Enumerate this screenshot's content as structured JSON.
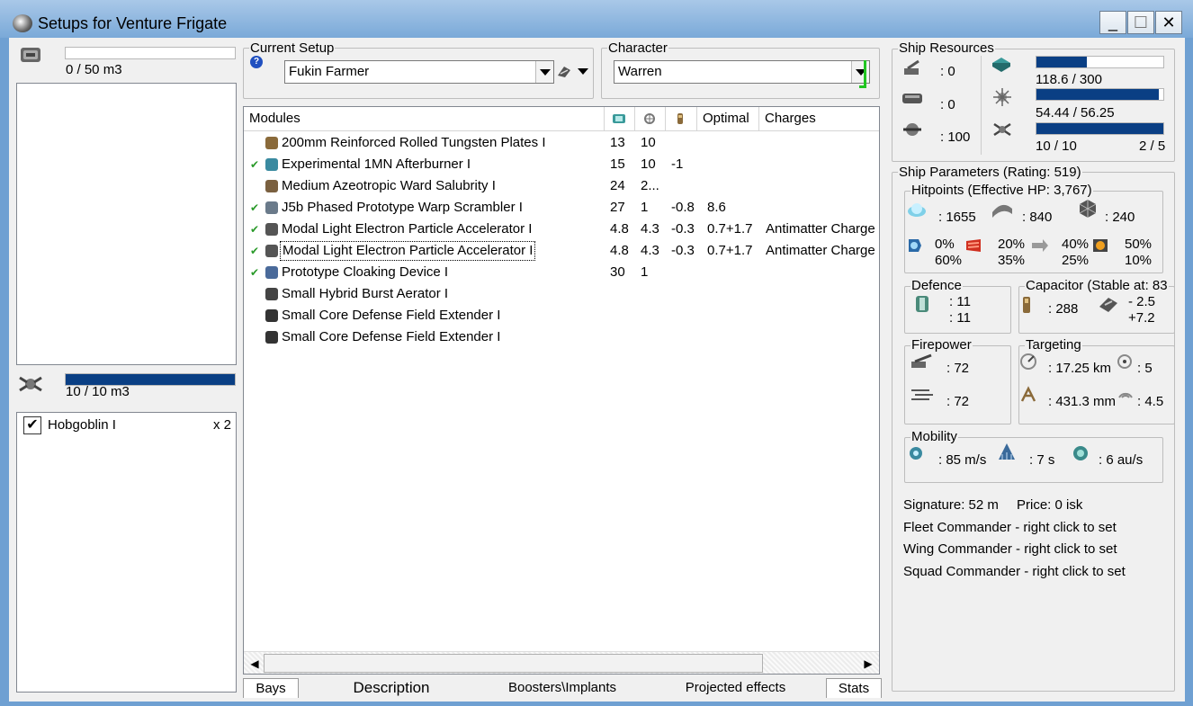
{
  "window": {
    "title": "Setups for Venture Frigate",
    "minimize": "_",
    "maximize": "☐",
    "close": "✕"
  },
  "cargo": {
    "capacity_text": "0 / 50 m3",
    "fill_fraction": 0.0
  },
  "drones": {
    "capacity_text": "10 / 10 m3",
    "fill_fraction": 1.0,
    "items": [
      {
        "name": "Hobgoblin I",
        "count": "x 2",
        "checked": true
      }
    ]
  },
  "current_setup": {
    "label": "Current Setup",
    "value": "Fukin Farmer"
  },
  "character": {
    "label": "Character",
    "value": "Warren"
  },
  "modules_table": {
    "headers": {
      "name": "Modules",
      "optimal": "Optimal",
      "charges": "Charges"
    },
    "rows": [
      {
        "name": "200mm Reinforced Rolled Tungsten Plates I",
        "cpu": "13",
        "pg": "10",
        "cap": "",
        "optimal": "",
        "charges": "",
        "active": false,
        "icon": "armor-plate-icon",
        "color": "#8a6a3a"
      },
      {
        "name": "Experimental 1MN Afterburner I",
        "cpu": "15",
        "pg": "10",
        "cap": "-1",
        "optimal": "",
        "charges": "",
        "active": true,
        "icon": "afterburner-icon",
        "color": "#3a8aa0"
      },
      {
        "name": "Medium Azeotropic Ward Salubrity I",
        "cpu": "24",
        "pg": "2...",
        "cap": "",
        "optimal": "",
        "charges": "",
        "active": false,
        "icon": "rig-icon",
        "color": "#7a6040"
      },
      {
        "name": "J5b Phased Prototype Warp Scrambler I",
        "cpu": "27",
        "pg": "1",
        "cap": "-0.8",
        "optimal": "8.6",
        "charges": "",
        "active": true,
        "icon": "warp-scrambler-icon",
        "color": "#6a7a8a"
      },
      {
        "name": "Modal Light Electron Particle Accelerator I",
        "cpu": "4.8",
        "pg": "4.3",
        "cap": "-0.3",
        "optimal": "0.7+1.7",
        "charges": "Antimatter Charge",
        "active": true,
        "icon": "hybrid-turret-icon",
        "color": "#555"
      },
      {
        "name": "Modal Light Electron Particle Accelerator I",
        "cpu": "4.8",
        "pg": "4.3",
        "cap": "-0.3",
        "optimal": "0.7+1.7",
        "charges": "Antimatter Charge",
        "active": true,
        "icon": "hybrid-turret-icon",
        "color": "#555"
      },
      {
        "name": "Prototype Cloaking Device I",
        "cpu": "30",
        "pg": "1",
        "cap": "",
        "optimal": "",
        "charges": "",
        "active": true,
        "icon": "cloak-icon",
        "color": "#4a6a9a"
      },
      {
        "name": "Small Hybrid Burst Aerator I",
        "cpu": "",
        "pg": "",
        "cap": "",
        "optimal": "",
        "charges": "",
        "active": false,
        "icon": "rig-icon",
        "color": "#444"
      },
      {
        "name": "Small Core Defense Field Extender I",
        "cpu": "",
        "pg": "",
        "cap": "",
        "optimal": "",
        "charges": "",
        "active": false,
        "icon": "shield-rig-icon",
        "color": "#333"
      },
      {
        "name": "Small Core Defense Field Extender I",
        "cpu": "",
        "pg": "",
        "cap": "",
        "optimal": "",
        "charges": "",
        "active": false,
        "icon": "shield-rig-icon",
        "color": "#333"
      }
    ]
  },
  "tabs": {
    "bays": "Bays",
    "description": "Description",
    "boosters": "Boosters\\Implants",
    "projected": "Projected effects",
    "stats": "Stats"
  },
  "ship_resources": {
    "label": "Ship Resources",
    "turret_slots": ": 0",
    "launcher_slots": ": 0",
    "calibration": ": 100",
    "cpu_text": "118.6 / 300",
    "cpu_fraction": 0.395,
    "pg_text": "54.44 / 56.25",
    "pg_fraction": 0.968,
    "drone_bw_text": "10 / 10",
    "drone_bw_fraction": 1.0,
    "drones_active": "2 / 5"
  },
  "ship_parameters": {
    "label": "Ship Parameters (Rating: 519)",
    "hitpoints": {
      "label": "Hitpoints (Effective HP: 3,767)",
      "shield": ": 1655",
      "armor": ": 840",
      "structure": ": 240",
      "em": [
        "0%",
        "60%"
      ],
      "thermal": [
        "20%",
        "35%"
      ],
      "kinetic": [
        "40%",
        "25%"
      ],
      "explosive": [
        "50%",
        "10%"
      ]
    },
    "defence": {
      "label": "Defence",
      "line1": ": 11",
      "line2": ": 11"
    },
    "capacitor": {
      "label": "Capacitor (Stable at: 83",
      "amount": ": 288",
      "line1": "- 2.5",
      "line2": "+7.2"
    },
    "firepower": {
      "label": "Firepower",
      "line1": ": 72",
      "line2": ": 72"
    },
    "targeting": {
      "label": "Targeting",
      "range": ": 17.25 km",
      "max_targets": ": 5",
      "resolution": ": 431.3 mm",
      "scan": ": 4.5"
    },
    "mobility": {
      "label": "Mobility",
      "speed": ": 85 m/s",
      "align": ": 7 s",
      "warp": ": 6 au/s"
    },
    "signature": "Signature: 52 m",
    "price": "Price: 0 isk",
    "fleet": "Fleet Commander - right click to set",
    "wing": "Wing Commander - right click to set",
    "squad": "Squad Commander - right click to set"
  }
}
